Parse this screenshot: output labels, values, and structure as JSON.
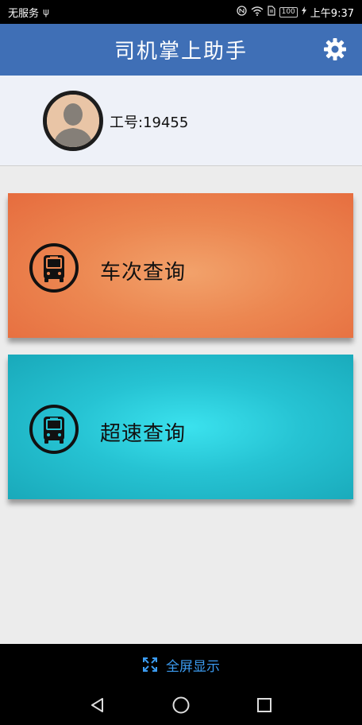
{
  "status_bar": {
    "carrier": "无服务",
    "usb_glyph": "ψ",
    "battery": "100",
    "time": "上午9:37"
  },
  "header": {
    "title": "司机掌上助手"
  },
  "profile": {
    "employee_id": "工号:19455"
  },
  "cards": [
    {
      "label": "车次查询",
      "icon": "bus-icon"
    },
    {
      "label": "超速查询",
      "icon": "bus-icon"
    }
  ],
  "fullscreen": {
    "label": "全屏显示",
    "color": "#3b9bf0"
  },
  "colors": {
    "header": "#3f6fb6",
    "card_orange": "#ec8751",
    "card_cyan": "#26c3d3"
  },
  "icons": {
    "settings": "gear-icon",
    "avatar": "person-avatar",
    "nav_back": "triangle-back-icon",
    "nav_home": "circle-home-icon",
    "nav_recents": "square-recents-icon"
  }
}
